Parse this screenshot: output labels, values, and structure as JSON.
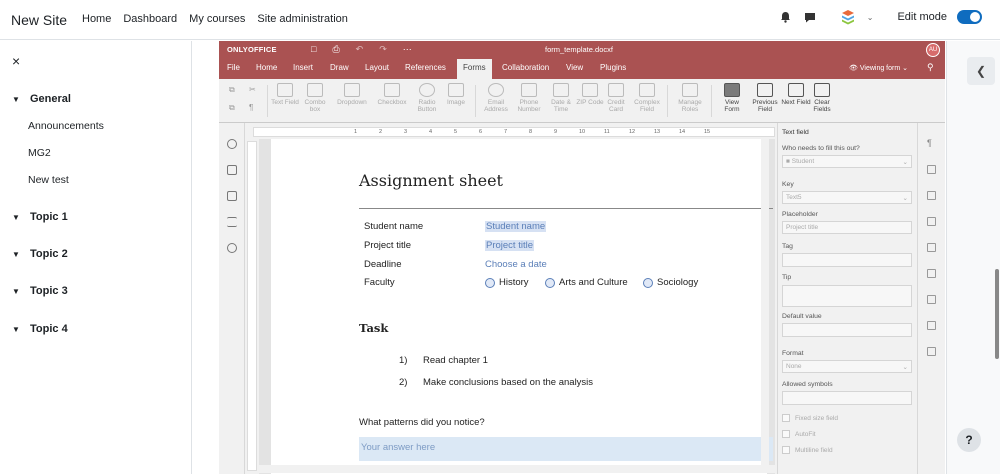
{
  "topnav": {
    "site_name": "New Site",
    "links": [
      "Home",
      "Dashboard",
      "My courses",
      "Site administration"
    ],
    "edit_mode_label": "Edit mode",
    "edit_mode_on": true
  },
  "course_index": {
    "close_icon": "×",
    "sections": [
      {
        "title": "General",
        "expanded": true,
        "items": [
          "Announcements",
          "MG2",
          "New test"
        ]
      },
      {
        "title": "Topic 1",
        "expanded": false
      },
      {
        "title": "Topic 2",
        "expanded": false
      },
      {
        "title": "Topic 3",
        "expanded": false
      },
      {
        "title": "Topic 4",
        "expanded": false
      }
    ]
  },
  "help_label": "?",
  "editor": {
    "logo": "ONLYOFFICE",
    "document_name": "form_template.docxf",
    "user_initials": "AU",
    "tabs": [
      "File",
      "Home",
      "Insert",
      "Draw",
      "Layout",
      "References",
      "Forms",
      "Collaboration",
      "View",
      "Plugins"
    ],
    "active_tab": "Forms",
    "view_mode": "Viewing form",
    "toolbar": {
      "text_field": "Text Field",
      "combo_box": "Combo box",
      "dropdown": "Dropdown",
      "checkbox": "Checkbox",
      "radio_button": "Radio Button",
      "image": "Image",
      "email_address": "Email Address",
      "phone_number": "Phone Number",
      "date_time": "Date & Time",
      "zip_code": "ZIP Code",
      "credit_card": "Credit Card",
      "complex_field": "Complex Field",
      "manage_roles": "Manage Roles",
      "view_form": "View Form",
      "previous_field": "Previous Field",
      "next_field": "Next Field",
      "clear_fields": "Clear Fields"
    },
    "ruler_marks": [
      "1",
      "2",
      "3",
      "4",
      "5",
      "6",
      "7",
      "8",
      "9",
      "10",
      "11",
      "12",
      "13",
      "14",
      "15"
    ],
    "document": {
      "title": "Assignment  sheet",
      "rows": [
        {
          "label": "Student name",
          "value": "Student name"
        },
        {
          "label": "Project title",
          "value": "Project title"
        },
        {
          "label": "Deadline",
          "value": "Choose a date"
        },
        {
          "label": "Faculty"
        }
      ],
      "faculty_options": [
        "History",
        "Arts and Culture",
        "Sociology"
      ],
      "task_heading": "Task",
      "task_items": [
        {
          "num": "1)",
          "text": "Read chapter 1"
        },
        {
          "num": "2)",
          "text": "Make conclusions based on the analysis"
        }
      ],
      "question": "What patterns did you notice?",
      "answer_placeholder": "Your answer here"
    },
    "settings_panel": {
      "heading": "Text field",
      "who_label": "Who needs to fill this out?",
      "who_value": "Student",
      "key_label": "Key",
      "key_value": "Text5",
      "placeholder_label": "Placeholder",
      "placeholder_value": "Project title",
      "tag_label": "Tag",
      "tip_label": "Tip",
      "default_value_label": "Default value",
      "format_label": "Format",
      "format_value": "None",
      "allowed_symbols_label": "Allowed symbols",
      "fixed_size": "Fixed size field",
      "autofit": "AutoFit",
      "multiline": "Multiline field"
    }
  }
}
